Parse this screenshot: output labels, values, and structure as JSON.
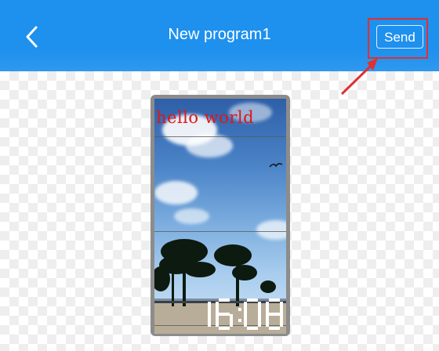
{
  "header": {
    "title": "New program1",
    "send_label": "Send",
    "back_icon": "chevron-left-icon",
    "background_color": "#1e90ee"
  },
  "annotation": {
    "highlight_color": "#e03030"
  },
  "preview": {
    "text_zone": {
      "text": "hello world",
      "color": "#e01515"
    },
    "clock_zone": {
      "time": "16:08"
    }
  }
}
